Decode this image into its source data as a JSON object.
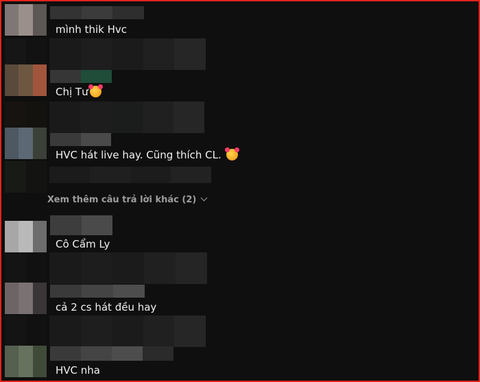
{
  "comments": [
    {
      "text": "mình thik Hvc"
    },
    {
      "text": "Chị Tư",
      "emoji": "smiling-face-with-hearts"
    },
    {
      "text": "HVC hát live hay. Cũng thích CL. ",
      "emoji": "smiling-face-with-hearts"
    },
    {
      "text": "Cô Cẩm Ly"
    },
    {
      "text": "cả 2 cs hát đều hay"
    },
    {
      "text": "HVC nha"
    }
  ],
  "more_replies": {
    "label": "Xem thêm câu trả lời khác (2)",
    "icon": "chevron-down-icon"
  },
  "colors": {
    "background": "#0f0f0f",
    "text": "#f1f1f1",
    "muted": "#9e9e9e",
    "frame_border": "#e0231b"
  }
}
